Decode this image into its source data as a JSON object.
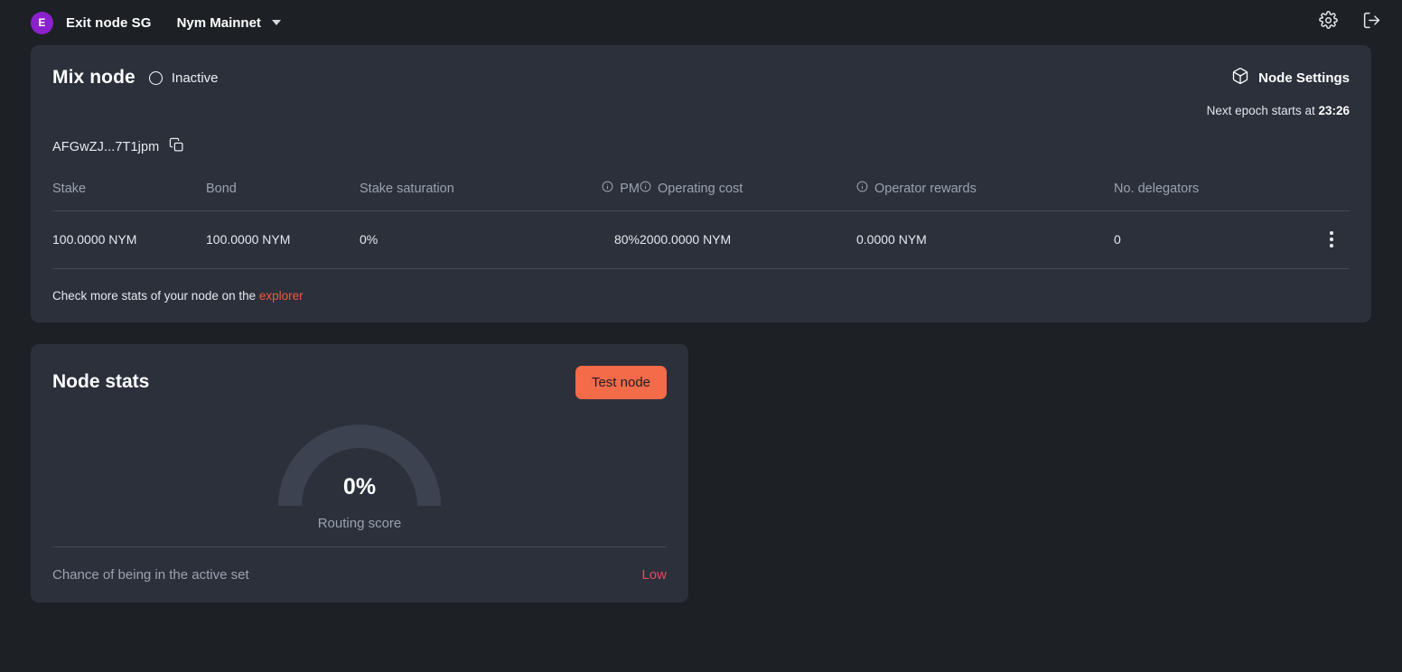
{
  "topbar": {
    "avatar_initial": "E",
    "brand_name": "Exit node SG",
    "network": "Nym Mainnet",
    "settings_icon": "gear-icon",
    "logout_icon": "logout-icon"
  },
  "node_card": {
    "title": "Mix node",
    "status": "Inactive",
    "status_icon": "empty-circle-icon",
    "settings_label": "Node Settings",
    "settings_icon": "cube-icon",
    "epoch_prefix": "Next epoch starts at",
    "epoch_time": "23:26",
    "node_id": "AFGwZJ...7T1jpm",
    "copy_icon": "copy-icon",
    "table": {
      "headers": [
        {
          "label": "Stake",
          "info": false,
          "align": "left"
        },
        {
          "label": "Bond",
          "info": false,
          "align": "left"
        },
        {
          "label": "Stake saturation",
          "info": false,
          "align": "left"
        },
        {
          "label": "PM",
          "info": true,
          "align": "right"
        },
        {
          "label": "Operating cost",
          "info": true,
          "align": "left"
        },
        {
          "label": "Operator rewards",
          "info": true,
          "align": "left"
        },
        {
          "label": "No. delegators",
          "info": false,
          "align": "left"
        }
      ],
      "row": {
        "stake": "100.0000 NYM",
        "bond": "100.0000 NYM",
        "stake_saturation": "0%",
        "pm": "80%",
        "operating_cost": "2000.0000 NYM",
        "operator_rewards": "0.0000 NYM",
        "no_delegators": "0",
        "menu_icon": "kebab-menu-icon"
      }
    },
    "footer_text": "Check more stats of your node on the",
    "footer_link": "explorer"
  },
  "stats_card": {
    "title": "Node stats",
    "test_button": "Test node",
    "gauge": {
      "value_label": "0%",
      "value": 0,
      "caption": "Routing score",
      "track_color": "#3c4250",
      "fill_color": "#f46b49"
    },
    "active_set_label": "Chance of being in the active set",
    "active_set_value": "Low",
    "active_set_color": "#e8485f"
  },
  "colors": {
    "page_bg": "#1d2025",
    "card_bg": "#2b303b",
    "accent": "#f46b49",
    "link": "#f2583e",
    "avatar": "#8b21cc",
    "muted": "#9ba2b0",
    "divider": "#424856"
  }
}
